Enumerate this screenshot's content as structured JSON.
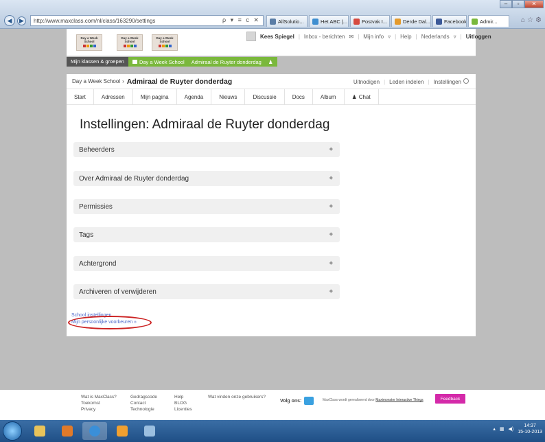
{
  "browser": {
    "url": "http://www.maxclass.com/nl/class/163290/settings",
    "addr_controls": "ρ ▾ ≡ c ✕",
    "tabs": [
      {
        "label": "AllSolutio...",
        "color": "#5a7da6"
      },
      {
        "label": "Het ABC |...",
        "color": "#3e8ed0"
      },
      {
        "label": "Postvak I...",
        "color": "#d6493e"
      },
      {
        "label": "Derde Dal...",
        "color": "#e49a2c"
      },
      {
        "label": "Facebook",
        "color": "#3b5998"
      },
      {
        "label": "Admir...",
        "color": "#7ab83c"
      }
    ]
  },
  "topbar": {
    "logo_text": "Day a Week School",
    "user_name": "Kees Spiegel",
    "inbox": "Inbox - berichten",
    "mijn_info": "Mijn info",
    "help": "Help",
    "language": "Nederlands",
    "logout": "Uitloggen"
  },
  "crumbbar": {
    "mijn_klassen": "Mijn klassen & groepen",
    "school": "Day a Week School",
    "group": "Admiraal de Ruyter donderdag"
  },
  "header": {
    "school": "Day a Week School",
    "sep": "›",
    "group": "Admiraal de Ruyter donderdag",
    "invite": "Uitnodigen",
    "members": "Leden indelen",
    "settings": "Instellingen"
  },
  "navtabs": [
    "Start",
    "Adressen",
    "Mijn pagina",
    "Agenda",
    "Nieuws",
    "Discussie",
    "Docs",
    "Album",
    "Chat"
  ],
  "page_title": "Instellingen: Admiraal de Ruyter donderdag",
  "panels": [
    {
      "label": "Beheerders"
    },
    {
      "label": "Over Admiraal de Ruyter donderdag"
    },
    {
      "label": "Permissies"
    },
    {
      "label": "Tags"
    },
    {
      "label": "Achtergrond"
    },
    {
      "label": "Archiveren of verwijderen"
    }
  ],
  "links": {
    "school_settings": "School instellingen",
    "personal_prefs": "Mijn persoonlijke voorkeuren »"
  },
  "footer": {
    "col1": [
      "Wat is MaxClass?",
      "Toekomst",
      "Privacy"
    ],
    "col2": [
      "Gedragscode",
      "Contact",
      "Technologie"
    ],
    "col3": [
      "Help",
      "BLOG",
      "Licenties"
    ],
    "users": "Wat vinden onze gebruikers?",
    "follow": "Volg ons:",
    "powered": "MaxClass wordt gerealiseerd door",
    "powered_by": "Maximonster Interactive Things",
    "feedback": "Feedback"
  },
  "taskbar": {
    "time": "14:37",
    "date": "15-10-2013"
  },
  "colors": {
    "accent_green": "#7ab83c",
    "feedback_pink": "#d42aa9",
    "link_blue": "#4a66c9",
    "highlight_red": "#cc2222"
  }
}
